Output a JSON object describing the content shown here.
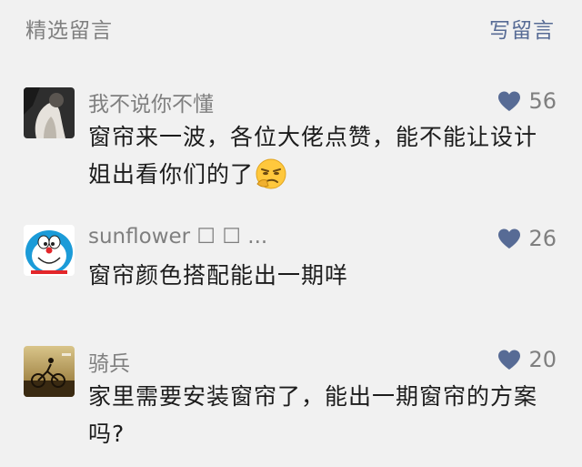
{
  "header": {
    "title": "精选留言",
    "write_label": "写留言"
  },
  "colors": {
    "background": "#f1f1f1",
    "link": "#576b95",
    "heart": "#576b95",
    "muted_text": "#7f7f7f"
  },
  "comments": [
    {
      "nickname": "我不说你不懂",
      "likes": "56",
      "content": "窗帘来一波，各位大佬点赞，能不能让设计姐出看你们的了",
      "emoji": "smirk-emoji"
    },
    {
      "nickname": "sunflower ☐ ☐ ...",
      "likes": "26",
      "content": "窗帘颜色搭配能出一期咩"
    },
    {
      "nickname": "骑兵",
      "likes": "20",
      "content": "家里需要安装窗帘了，能出一期窗帘的方案吗?"
    }
  ]
}
